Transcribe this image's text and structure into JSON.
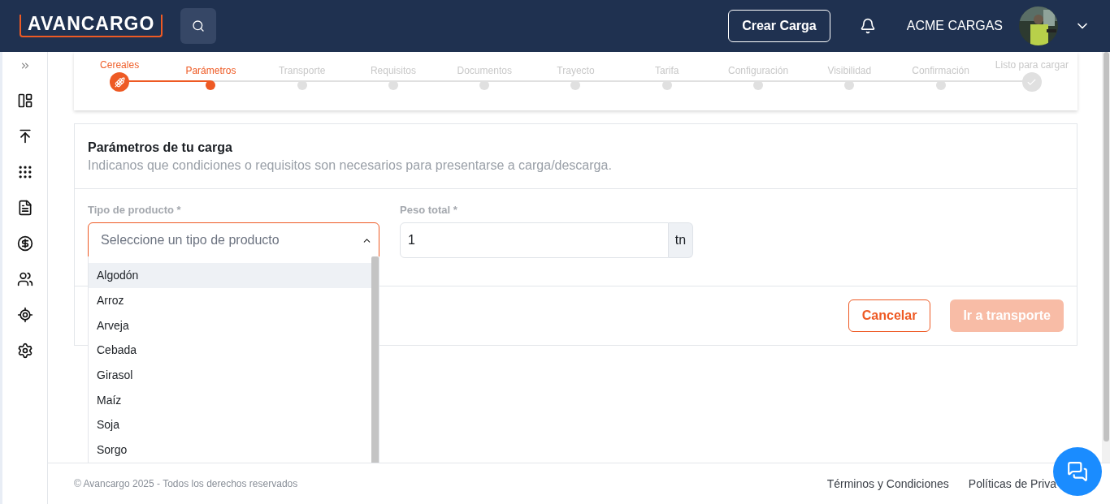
{
  "header": {
    "logo": "AVANCARGO",
    "create_button": "Crear Carga",
    "company": "ACME CARGAS"
  },
  "stepper": [
    {
      "label": "Cereales",
      "kind": "category",
      "completed": true,
      "selected": false
    },
    {
      "label": "Parámetros",
      "kind": "step",
      "completed": false,
      "selected": true
    },
    {
      "label": "Transporte",
      "kind": "step",
      "completed": false,
      "selected": false
    },
    {
      "label": "Requisitos",
      "kind": "step",
      "completed": false,
      "selected": false
    },
    {
      "label": "Documentos",
      "kind": "step",
      "completed": false,
      "selected": false
    },
    {
      "label": "Trayecto",
      "kind": "step",
      "completed": false,
      "selected": false
    },
    {
      "label": "Tarifa",
      "kind": "step",
      "completed": false,
      "selected": false
    },
    {
      "label": "Configuración",
      "kind": "step",
      "completed": false,
      "selected": false
    },
    {
      "label": "Visibilidad",
      "kind": "step",
      "completed": false,
      "selected": false
    },
    {
      "label": "Confirmación",
      "kind": "step",
      "completed": false,
      "selected": false
    },
    {
      "label": "Listo para cargar",
      "kind": "finish",
      "completed": false,
      "selected": false
    }
  ],
  "form": {
    "title": "Parámetros de tu carga",
    "subtitle": "Indicanos que condiciones o requisitos son necesarios para presentarse a carga/descarga.",
    "product": {
      "label": "Tipo de producto *",
      "placeholder": "Seleccione un tipo de producto",
      "expanded": true,
      "options": [
        {
          "label": "Algodón",
          "highlighted": true
        },
        {
          "label": "Arroz",
          "highlighted": false
        },
        {
          "label": "Arveja",
          "highlighted": false
        },
        {
          "label": "Cebada",
          "highlighted": false
        },
        {
          "label": "Girasol",
          "highlighted": false
        },
        {
          "label": "Maíz",
          "highlighted": false
        },
        {
          "label": "Soja",
          "highlighted": false
        },
        {
          "label": "Sorgo",
          "highlighted": false
        }
      ]
    },
    "weight": {
      "label": "Peso total *",
      "value": "1",
      "unit": "tn"
    },
    "buttons": [
      {
        "label": "Cancelar",
        "kind": "outline",
        "disabled": false
      },
      {
        "label": "Ir a transporte",
        "kind": "primary",
        "disabled": true
      }
    ]
  },
  "footer": {
    "copyright": "© Avancargo 2025 - Todos los derechos reservados",
    "links": [
      "Términos y Condiciones",
      "Políticas de Priva"
    ]
  }
}
